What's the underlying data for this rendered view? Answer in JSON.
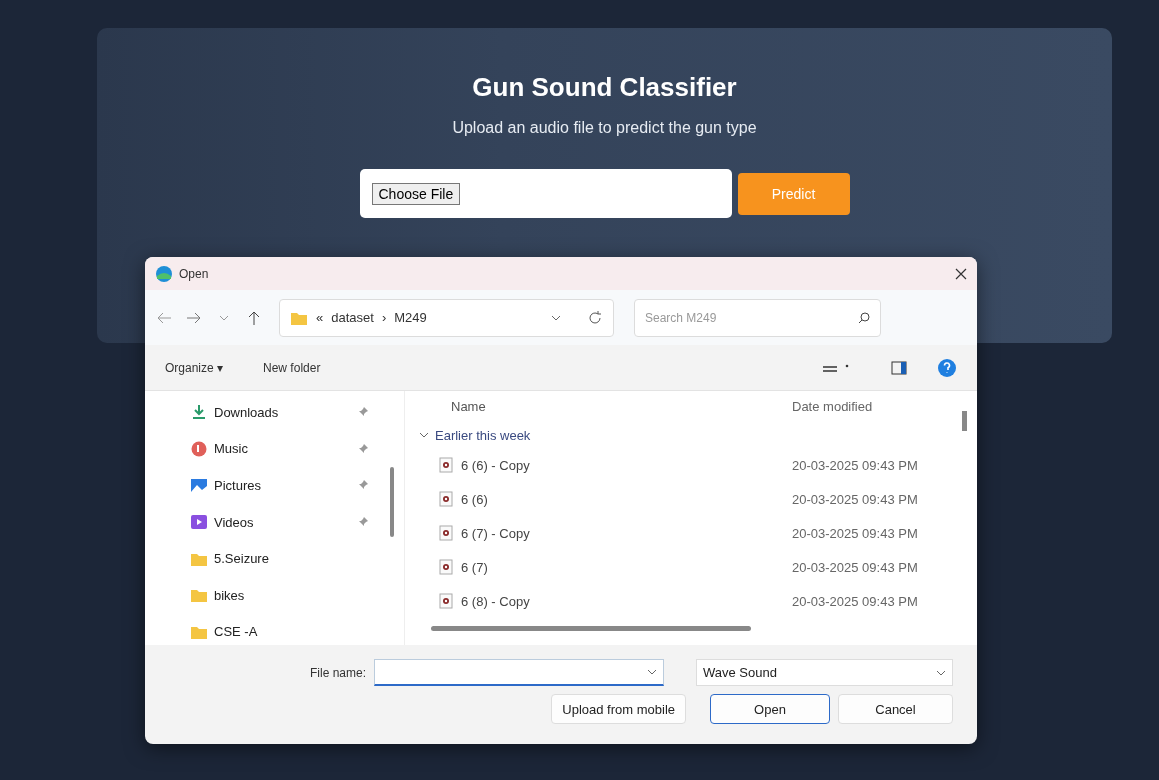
{
  "page": {
    "title": "Gun Sound Classifier",
    "subtitle": "Upload an audio file to predict the gun type",
    "file_button": "Choose File",
    "predict_button": "Predict"
  },
  "dialog": {
    "title": "Open",
    "breadcrumb": [
      "«",
      "dataset",
      "›",
      "M249"
    ],
    "search": {
      "placeholder": "Search M249"
    },
    "commands": [
      {
        "label": "Organize ▾"
      },
      {
        "label": "New folder"
      }
    ],
    "sidebar": [
      {
        "label": "Downloads",
        "kind": "download",
        "pinned": true
      },
      {
        "label": "Music",
        "kind": "music",
        "pinned": true
      },
      {
        "label": "Pictures",
        "kind": "pictures",
        "pinned": true
      },
      {
        "label": "Videos",
        "kind": "videos",
        "pinned": true
      },
      {
        "label": "5.Seizure",
        "kind": "folder",
        "pinned": false
      },
      {
        "label": "bikes",
        "kind": "folder",
        "pinned": false
      },
      {
        "label": "CSE -A",
        "kind": "folder",
        "pinned": false
      }
    ],
    "columns": [
      "Name",
      "Date modified"
    ],
    "group": "Earlier this week",
    "files": [
      {
        "name": "6 (6) - Copy",
        "date": "20-03-2025 09:43 PM"
      },
      {
        "name": "6 (6)",
        "date": "20-03-2025 09:43 PM"
      },
      {
        "name": "6 (7) - Copy",
        "date": "20-03-2025 09:43 PM"
      },
      {
        "name": "6 (7)",
        "date": "20-03-2025 09:43 PM"
      },
      {
        "name": "6 (8) - Copy",
        "date": "20-03-2025 09:43 PM"
      }
    ],
    "file_name_label": "File name:",
    "file_type": "Wave Sound",
    "buttons": [
      {
        "label": "Upload from mobile",
        "kind": "plain"
      },
      {
        "label": "Open",
        "kind": "primary"
      },
      {
        "label": "Cancel",
        "kind": "plain"
      }
    ]
  }
}
